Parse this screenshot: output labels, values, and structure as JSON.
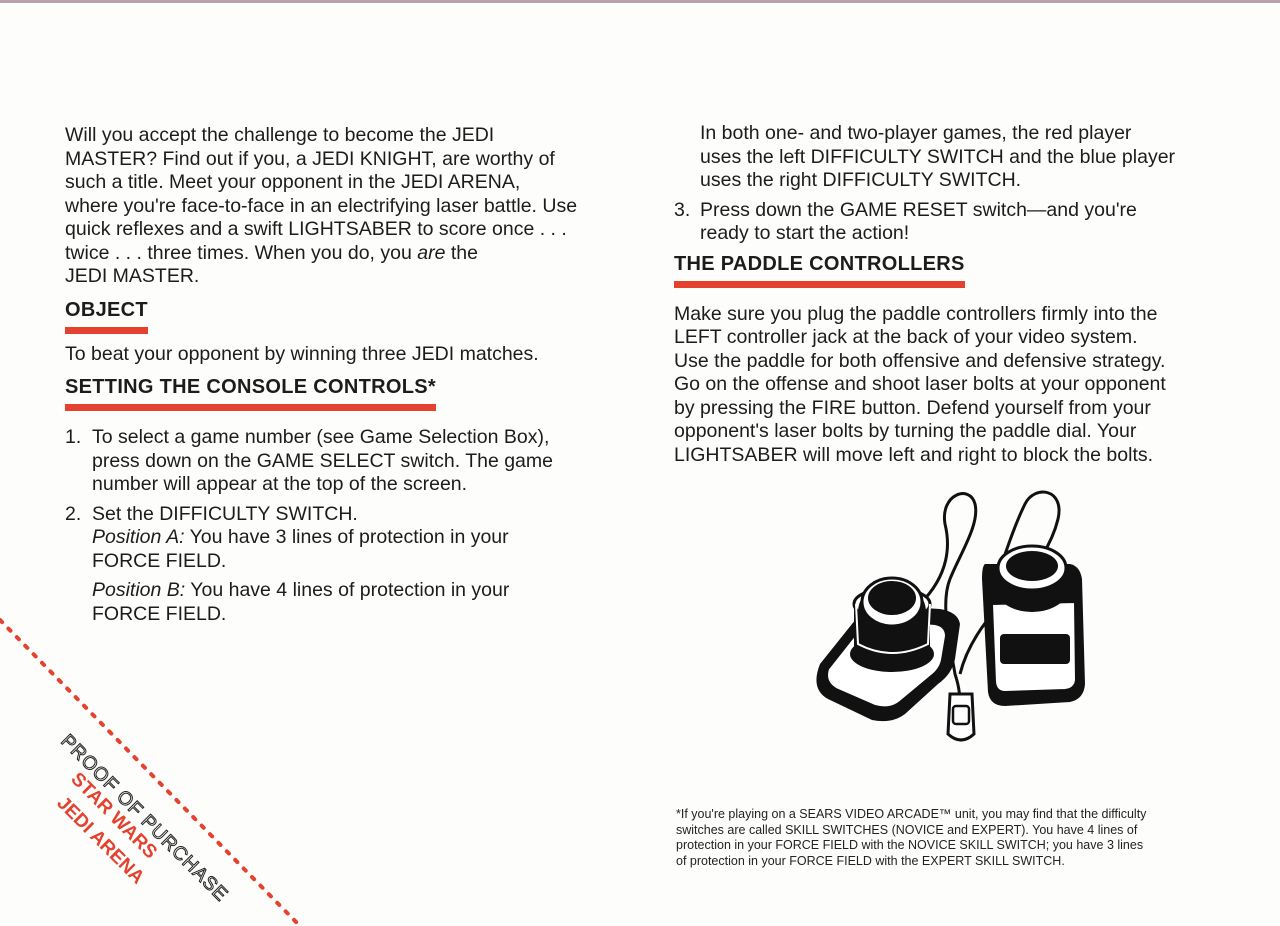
{
  "intro": {
    "line1": "Will you accept the challenge to become the JEDI",
    "line2": "MASTER? Find out if you, a JEDI KNIGHT, are worthy of",
    "line3": "such a title. Meet your opponent in the JEDI ARENA,",
    "line4": "where you're face-to-face in an electrifying laser battle. Use",
    "line5": "quick reflexes and a swift LIGHTSABER to score once . . .",
    "line6_pre": "twice . . . three times. When you do, you ",
    "line6_em": "are",
    "line6_post": " the",
    "line7": "JEDI MASTER."
  },
  "object": {
    "heading": "OBJECT",
    "text": "To beat your opponent by winning three JEDI matches."
  },
  "console": {
    "heading": "SETTING THE CONSOLE CONTROLS*",
    "step1": {
      "num": "1.",
      "l1": "To select a game number (see Game Selection Box),",
      "l2": "press down on the GAME SELECT switch. The game",
      "l3": "number will appear at the top of the screen."
    },
    "step2": {
      "num": "2.",
      "l1": "Set the DIFFICULTY SWITCH.",
      "posA_label": "Position A:",
      "posA_l1": " You have 3 lines of protection in your",
      "posA_l2": "FORCE FIELD.",
      "posB_label": "Position B:",
      "posB_l1": " You have 4 lines of protection in your",
      "posB_l2": "FORCE FIELD."
    },
    "cont": {
      "l1": "In both one- and two-player games, the red player",
      "l2": "uses the left DIFFICULTY SWITCH and the blue player",
      "l3": "uses the right DIFFICULTY SWITCH."
    },
    "step3": {
      "num": "3.",
      "l1": "Press down the GAME RESET switch—and you're",
      "l2": "ready to start the action!"
    }
  },
  "paddle": {
    "heading": "THE PADDLE CONTROLLERS",
    "l1": "Make sure you plug the paddle controllers firmly into the",
    "l2": "LEFT controller jack at the back of your video system.",
    "l3": "Use the paddle for both offensive and defensive strategy.",
    "l4": "Go on the offense and shoot laser bolts at your opponent",
    "l5": "by pressing the FIRE button. Defend yourself from your",
    "l6": "opponent's laser bolts by turning the paddle dial. Your",
    "l7": "LIGHTSABER will move left and right to block the bolts."
  },
  "footnote": {
    "l1": "*If you're playing on a SEARS VIDEO ARCADE™ unit, you may find that the difficulty",
    "l2": "switches are called SKILL SWITCHES (NOVICE and EXPERT). You have 4 lines of",
    "l3": "protection in your FORCE FIELD with the NOVICE SKILL SWITCH; you have 3 lines",
    "l4": "of protection in your FORCE FIELD with the EXPERT SKILL SWITCH."
  },
  "proof": {
    "label": "PROOF OF PURCHASE",
    "title1": "STAR WARS",
    "title2": "JEDI ARENA"
  },
  "colors": {
    "accent_red": "#e4412e",
    "text": "#1c1c1c"
  }
}
